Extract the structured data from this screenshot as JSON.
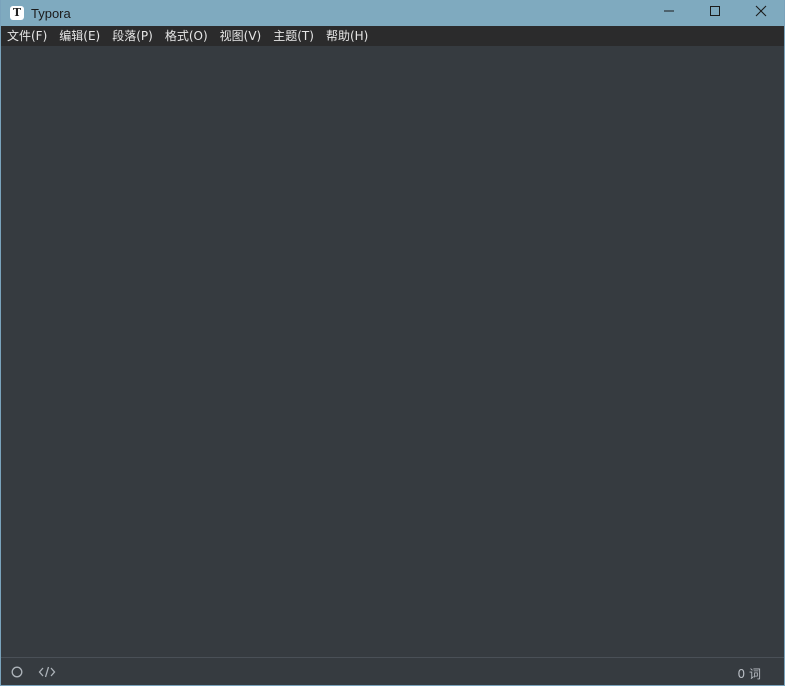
{
  "window": {
    "title": "Typora",
    "app_icon_letter": "T",
    "controls": {
      "minimize_icon": "minimize-icon",
      "maximize_icon": "maximize-icon",
      "close_icon": "close-icon"
    }
  },
  "menubar": {
    "items": [
      {
        "label": "文件(F)"
      },
      {
        "label": "编辑(E)"
      },
      {
        "label": "段落(P)"
      },
      {
        "label": "格式(O)"
      },
      {
        "label": "视图(V)"
      },
      {
        "label": "主题(T)"
      },
      {
        "label": "帮助(H)"
      }
    ]
  },
  "editor": {
    "content": ""
  },
  "statusbar": {
    "outline_icon": "circle-icon",
    "source_icon": "code-icon",
    "word_count": "0 词"
  },
  "colors": {
    "titlebar": "#7faabf",
    "menubar": "#2b2b2c",
    "editor_bg": "#363b40",
    "menu_text": "#e6e6e6"
  }
}
